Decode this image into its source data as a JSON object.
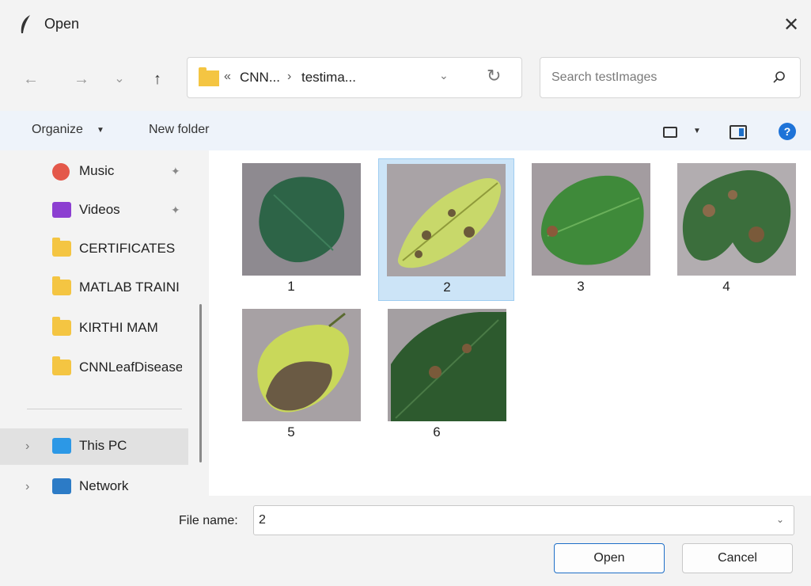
{
  "window": {
    "title": "Open",
    "close_glyph": "✕"
  },
  "nav": {
    "back_glyph": "←",
    "forward_glyph": "→",
    "recent_glyph": "⌄",
    "up_glyph": "↑"
  },
  "address": {
    "sep1": "«",
    "crumb1": "CNN...",
    "sep2": "›",
    "crumb2": "testima...",
    "dropdown_glyph": "⌄",
    "refresh_glyph": "↻"
  },
  "search": {
    "placeholder": "Search testImages"
  },
  "commandbar": {
    "organize": "Organize",
    "caret": "▼",
    "new_folder": "New folder",
    "help_glyph": "?"
  },
  "sidebar": {
    "items": [
      {
        "label": "Music",
        "icon": "music-icon",
        "pinned": true
      },
      {
        "label": "Videos",
        "icon": "videos-icon",
        "pinned": true
      },
      {
        "label": "CERTIFICATES",
        "icon": "folder-icon",
        "pinned": false
      },
      {
        "label": "MATLAB TRAINI",
        "icon": "folder-icon",
        "pinned": false
      },
      {
        "label": "KIRTHI MAM",
        "icon": "folder-icon",
        "pinned": false
      },
      {
        "label": "CNNLeafDisease",
        "icon": "folder-icon",
        "pinned": false
      }
    ],
    "this_pc": "This PC",
    "network": "Network",
    "chevron_glyph": "›",
    "pin_glyph": "✦"
  },
  "files": [
    {
      "name": "1",
      "selected": false
    },
    {
      "name": "2",
      "selected": true
    },
    {
      "name": "3",
      "selected": false
    },
    {
      "name": "4",
      "selected": false
    },
    {
      "name": "5",
      "selected": false
    },
    {
      "name": "6",
      "selected": false
    }
  ],
  "footer": {
    "file_name_label": "File name:",
    "file_name_value": "2",
    "dropdown_glyph": "⌄",
    "open_label": "Open",
    "cancel_label": "Cancel"
  },
  "colors": {
    "accent": "#1e6fc8",
    "selection": "#cce4f7",
    "folder": "#f4c542"
  }
}
